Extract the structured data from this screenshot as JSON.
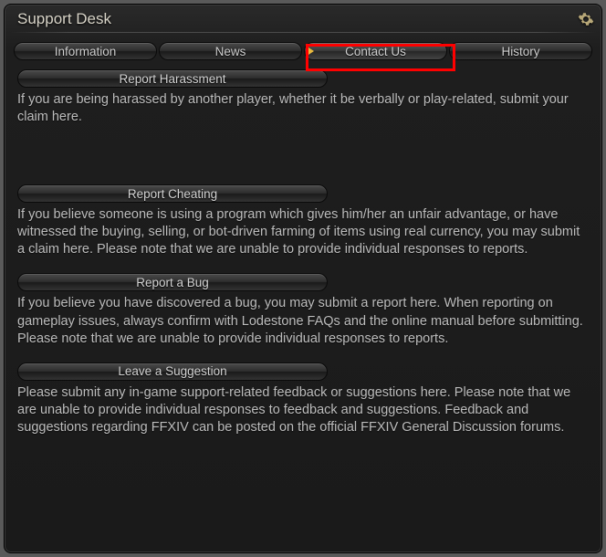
{
  "window": {
    "title": "Support Desk"
  },
  "tabs": [
    {
      "label": "Information"
    },
    {
      "label": "News"
    },
    {
      "label": "Contact Us"
    },
    {
      "label": "History"
    }
  ],
  "sections": [
    {
      "title": "Report Harassment",
      "body": "If you are being harassed by another player, whether it be verbally or play-related, submit your claim here."
    },
    {
      "title": "Report Cheating",
      "body": "If you believe someone is using a program which gives him/her an unfair advantage, or have witnessed the buying, selling, or bot-driven farming of items using real currency, you may submit a claim here. Please note that we are unable to provide individual responses to reports."
    },
    {
      "title": "Report a Bug",
      "body": "If you believe you have discovered a bug, you may submit a report here. When reporting on gameplay issues, always confirm with Lodestone FAQs and the online manual before submitting. Please note that we are unable to provide individual responses to reports."
    },
    {
      "title": "Leave a Suggestion",
      "body": "Please submit any in-game support-related feedback or suggestions here. Please note that we are unable to provide individual responses to feedback and suggestions. Feedback and suggestions regarding FFXIV can be posted on the official FFXIV General Discussion forums."
    }
  ]
}
